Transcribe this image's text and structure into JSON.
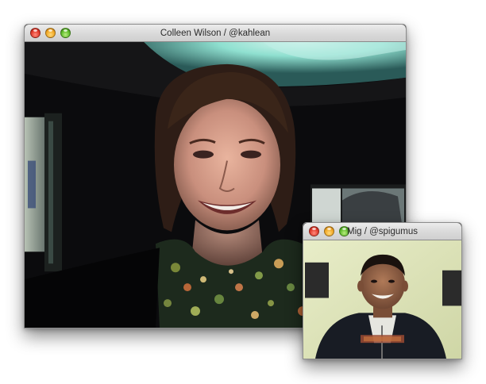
{
  "main_window": {
    "title": "Colleen Wilson / @kahlean",
    "video_icon": "video-feed"
  },
  "small_window": {
    "title": "Mig / @spigumus",
    "video_icon": "video-feed"
  },
  "colors": {
    "close_button": "#e0392b",
    "minimize_button": "#f1a825",
    "zoom_button": "#5fbb2b",
    "titlebar": "#dcdcdc"
  }
}
